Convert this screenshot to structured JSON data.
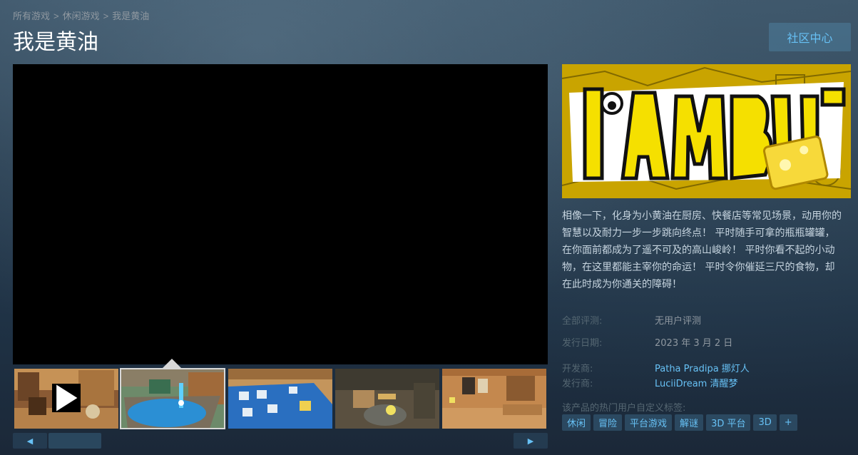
{
  "breadcrumb": {
    "items": [
      "所有游戏",
      "休闲游戏",
      "我是黄油"
    ],
    "separator": ">"
  },
  "title": "我是黄油",
  "community_button": "社区中心",
  "media": {
    "thumbnails": [
      {
        "kind": "video",
        "icon": "play-icon"
      },
      {
        "kind": "screenshot",
        "selected": true
      },
      {
        "kind": "screenshot"
      },
      {
        "kind": "screenshot"
      },
      {
        "kind": "screenshot"
      }
    ],
    "scroll_left_icon": "◀",
    "scroll_right_icon": "▶"
  },
  "capsule": {
    "logo_text": "I AM BUTTER"
  },
  "description": "相像一下，化身为小黄油在厨房、快餐店等常见场景，动用你的智慧以及耐力一步一步跳向终点！ 平时随手可拿的瓶瓶罐罐，在你面前都成为了遥不可及的高山峻岭！ 平时你看不起的小动物，在这里都能主宰你的命运！ 平时令你催延三尺的食物，却在此时成为你通关的障碍！",
  "info": {
    "reviews_label": "全部评测:",
    "reviews_value": "无用户评测",
    "release_label": "发行日期:",
    "release_value": "2023 年 3 月 2 日",
    "developer_label": "开发商:",
    "developer_value": "Patha Pradipa 挪灯人",
    "publisher_label": "发行商:",
    "publisher_value": "LuciiDream 清醒梦"
  },
  "tags_label": "该产品的热门用户自定义标签:",
  "tags": [
    "休闲",
    "冒险",
    "平台游戏",
    "解谜",
    "3D 平台",
    "3D",
    "+"
  ],
  "colors": {
    "background": "#1b2838",
    "accent": "#67c1f5",
    "label": "#556772",
    "capsule_yellow": "#f5e000"
  }
}
